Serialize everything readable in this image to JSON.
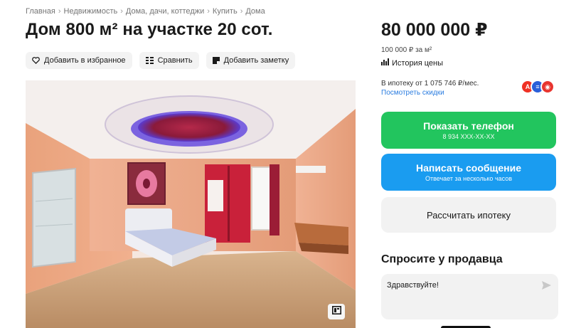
{
  "breadcrumb": [
    "Главная",
    "Недвижимость",
    "Дома, дачи, коттеджи",
    "Купить",
    "Дома"
  ],
  "title": "Дом 800 м² на участке 20 сот.",
  "actions": {
    "favorite": "Добавить в избранное",
    "compare": "Сравнить",
    "note": "Добавить заметку"
  },
  "price": {
    "total": "80 000 000 ₽",
    "per_meter": "100 000 ₽ за м²",
    "history": "История цены"
  },
  "mortgage": {
    "line": "В ипотеку от 1 075 746 ₽/мес.",
    "link": "Посмотреть скидки",
    "banks": [
      {
        "letter": "A",
        "color": "#ef3124"
      },
      {
        "letter": "≡",
        "color": "#2b5fd9"
      },
      {
        "letter": "◉",
        "color": "#e8352f"
      }
    ]
  },
  "buttons": {
    "phone": {
      "label": "Показать телефон",
      "sub": "8 934 XXX-XX-XX"
    },
    "message": {
      "label": "Написать сообщение",
      "sub": "Отвечает за несколько часов"
    },
    "calc": {
      "label": "Рассчитать ипотеку"
    }
  },
  "ask": {
    "heading": "Спросите у продавца",
    "input_value": "Здравствуйте!"
  },
  "colors": {
    "green": "#22c55e",
    "blue": "#1a9cf0",
    "link": "#2b7de0"
  },
  "icons": {
    "favorite": "heart-icon",
    "compare": "compare-icon",
    "note": "note-icon",
    "history": "bar-chart-icon",
    "send": "send-icon",
    "gallery": "gallery-icon"
  }
}
